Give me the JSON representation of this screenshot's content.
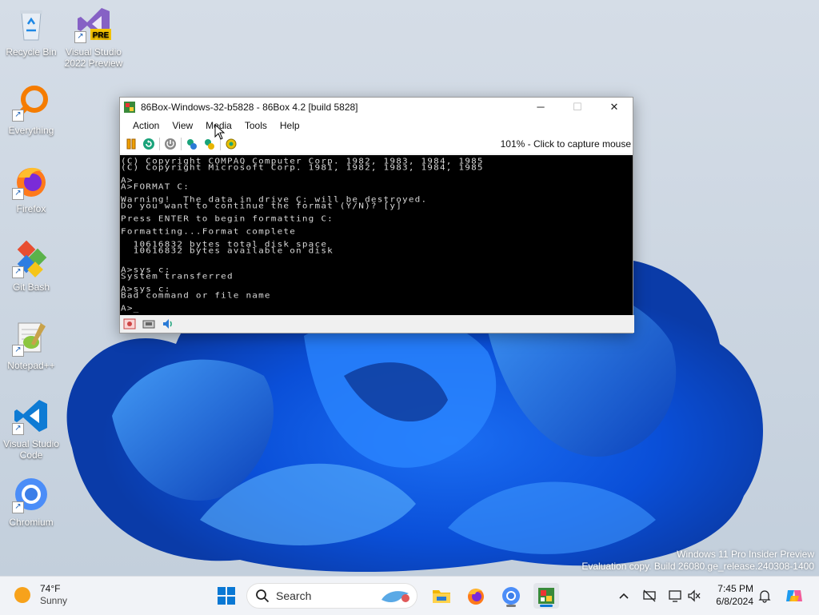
{
  "desktop": {
    "icons": [
      {
        "label": "Recycle Bin",
        "icon": "recycle-bin-icon"
      },
      {
        "label": "Visual Studio 2022 Preview",
        "icon": "visual-studio-preview-icon",
        "badge": "PRE"
      },
      {
        "label": "Everything",
        "icon": "everything-search-icon"
      },
      {
        "label": "Firefox",
        "icon": "firefox-icon"
      },
      {
        "label": "Git Bash",
        "icon": "git-bash-icon"
      },
      {
        "label": "Notepad++",
        "icon": "notepad-plus-plus-icon"
      },
      {
        "label": "Visual Studio Code",
        "icon": "vscode-icon"
      },
      {
        "label": "Chromium",
        "icon": "chromium-icon"
      }
    ]
  },
  "window": {
    "title": "86Box-Windows-32-b5828 - 86Box 4.2 [build 5828]",
    "menu": [
      "Action",
      "View",
      "Media",
      "Tools",
      "Help"
    ],
    "capture_text": "101% - Click to capture mouse",
    "controls": {
      "minimize": "─",
      "maximize": "☐",
      "close": "✕"
    }
  },
  "terminal": {
    "lines": [
      "(C) Copyright COMPAQ Computer Corp. 1982, 1983, 1984, 1985",
      "(C) Copyright Microsoft Corp. 1981, 1982, 1983, 1984, 1985",
      "",
      "A>",
      "A>FORMAT C:",
      "",
      "Warning!  The data in drive C: will be destroyed.",
      "Do you want to continue the format (Y/N)? [y]",
      "",
      "Press ENTER to begin formatting C:",
      "",
      "Formatting...Format complete",
      "",
      "  10616832 bytes total disk space",
      "  10616832 bytes available on disk",
      "",
      "",
      "A>sys c:",
      "System transferred",
      "",
      "A>sys c:",
      "Bad command or file name",
      "",
      "A>_"
    ]
  },
  "watermark": {
    "line1": "Windows 11 Pro Insider Preview",
    "line2": "Evaluation copy. Build 26080.ge_release.240308-1400"
  },
  "taskbar": {
    "weather_temp": "74°F",
    "weather_desc": "Sunny",
    "search_placeholder": "Search",
    "time": "7:45 PM",
    "date": "6/8/2024"
  }
}
